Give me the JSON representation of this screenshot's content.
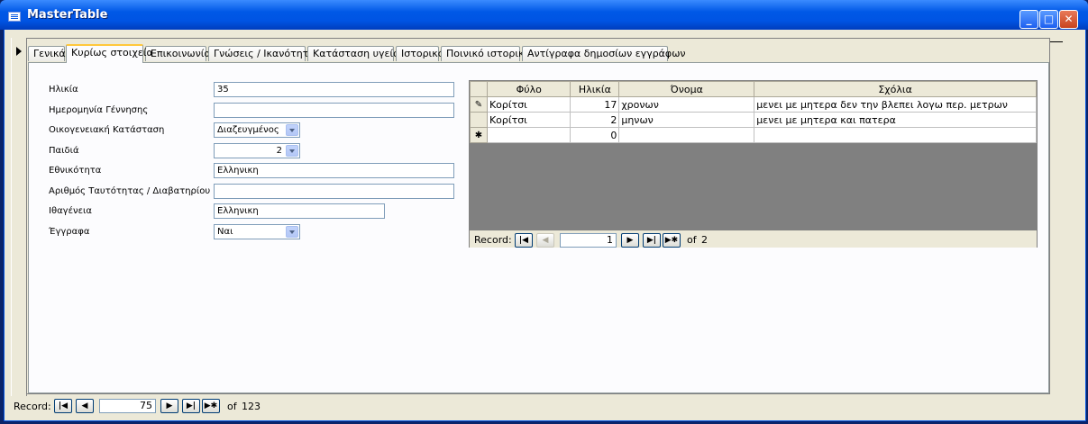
{
  "window": {
    "title": "MasterTable",
    "min_label": "_",
    "max_label": "□",
    "close_label": "✕"
  },
  "tabs": [
    {
      "label": "Γενικά"
    },
    {
      "label": "Κυρίως στοιχεία"
    },
    {
      "label": "Επικοινωνία"
    },
    {
      "label": "Γνώσεις / Ικανότητες"
    },
    {
      "label": "Κατάσταση υγείας"
    },
    {
      "label": "Ιστορικό"
    },
    {
      "label": "Ποινικό ιστορικό"
    },
    {
      "label": "Αντίγραφα δημοσίων εγγράφων"
    }
  ],
  "form": {
    "age_label": "Ηλικία",
    "age_value": "35",
    "dob_label": "Ημερομηνία Γέννησης",
    "dob_value": "",
    "marital_label": "Οικογενειακή Κατάσταση",
    "marital_value": "Διαζευγμένος",
    "children_label": "Παιδιά",
    "children_value": "2",
    "ethnicity_label": "Εθνικότητα",
    "ethnicity_value": "Ελληνικη",
    "id_label": "Αριθμός Ταυτότητας / Διαβατηρίου",
    "id_value": "",
    "citizenship_label": "Ιθαγένεια",
    "citizenship_value": "Ελληνικη",
    "docs_label": "Έγγραφα",
    "docs_value": "Ναι"
  },
  "subform": {
    "columns": [
      "Φύλο",
      "Ηλικία",
      "Όνομα",
      "Σχόλια"
    ],
    "rows": [
      {
        "selector": "✎",
        "sex": "Κορίτσι",
        "age": "17",
        "name": "χρονων",
        "comments": "μενει με μητερα δεν την βλεπει λογω περ. μετρων"
      },
      {
        "selector": "",
        "sex": "Κορίτσι",
        "age": "2",
        "name": "μηνων",
        "comments": "μενει με μητερα και πατερα"
      },
      {
        "selector": "✱",
        "sex": "",
        "age": "0",
        "name": "",
        "comments": ""
      }
    ],
    "nav": {
      "label": "Record:",
      "current": "1",
      "of_label": "of",
      "total": "2"
    }
  },
  "main_nav": {
    "label": "Record:",
    "current": "75",
    "of_label": "of",
    "total": "123"
  },
  "icons": {
    "first": "first-record-icon",
    "prev": "prev-record-icon",
    "next": "next-record-icon",
    "last": "last-record-icon",
    "new": "new-record-icon"
  },
  "colors": {
    "titlebar": "#0054e3",
    "tab_highlight": "#ffc83c",
    "subform_bg": "#808080"
  }
}
